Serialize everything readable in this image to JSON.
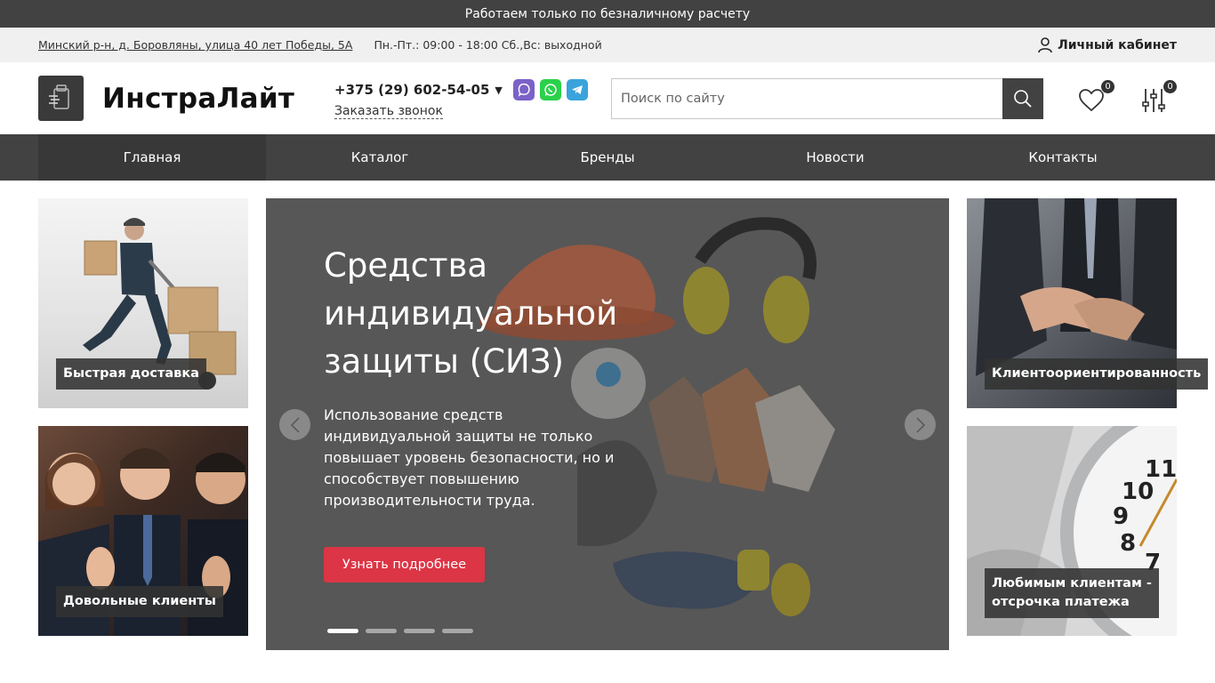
{
  "topbar": {
    "text": "Работаем только по безналичному расчету"
  },
  "info": {
    "address": "Минский р-н, д. Боровляны, улица 40 лет Победы, 5А",
    "hours": "Пн.-Пт.: 09:00 - 18:00 Сб.,Вс: выходной",
    "account_label": "Личный кабинет"
  },
  "header": {
    "logo_text": "ИнстраЛайт",
    "phone": "+375 (29) 602-54-05",
    "callback_label": "Заказать звонок",
    "search_placeholder": "Поиск по сайту",
    "favorites_count": "0",
    "compare_count": "0"
  },
  "nav": {
    "items": [
      "Главная",
      "Каталог",
      "Бренды",
      "Новости",
      "Контакты"
    ],
    "active": "Главная"
  },
  "tiles": {
    "delivery": "Быстрая доставка",
    "clients": "Довольные клиенты",
    "client_focus": "Клиентоориентированность",
    "deferred": "Любимым клиентам - отсрочка платежа"
  },
  "slider": {
    "title": "Средства индивидуальной защиты (СИЗ)",
    "text": "Использование средств индивидуальной защиты не только повышает уровень безопасности, но и способствует повышению производительности труда.",
    "button_label": "Узнать подробнее",
    "slide_count": 4,
    "active_slide": 1
  },
  "colors": {
    "dark": "#424242",
    "accent": "#dc3545",
    "infobar_bg": "#f0f0f0"
  }
}
